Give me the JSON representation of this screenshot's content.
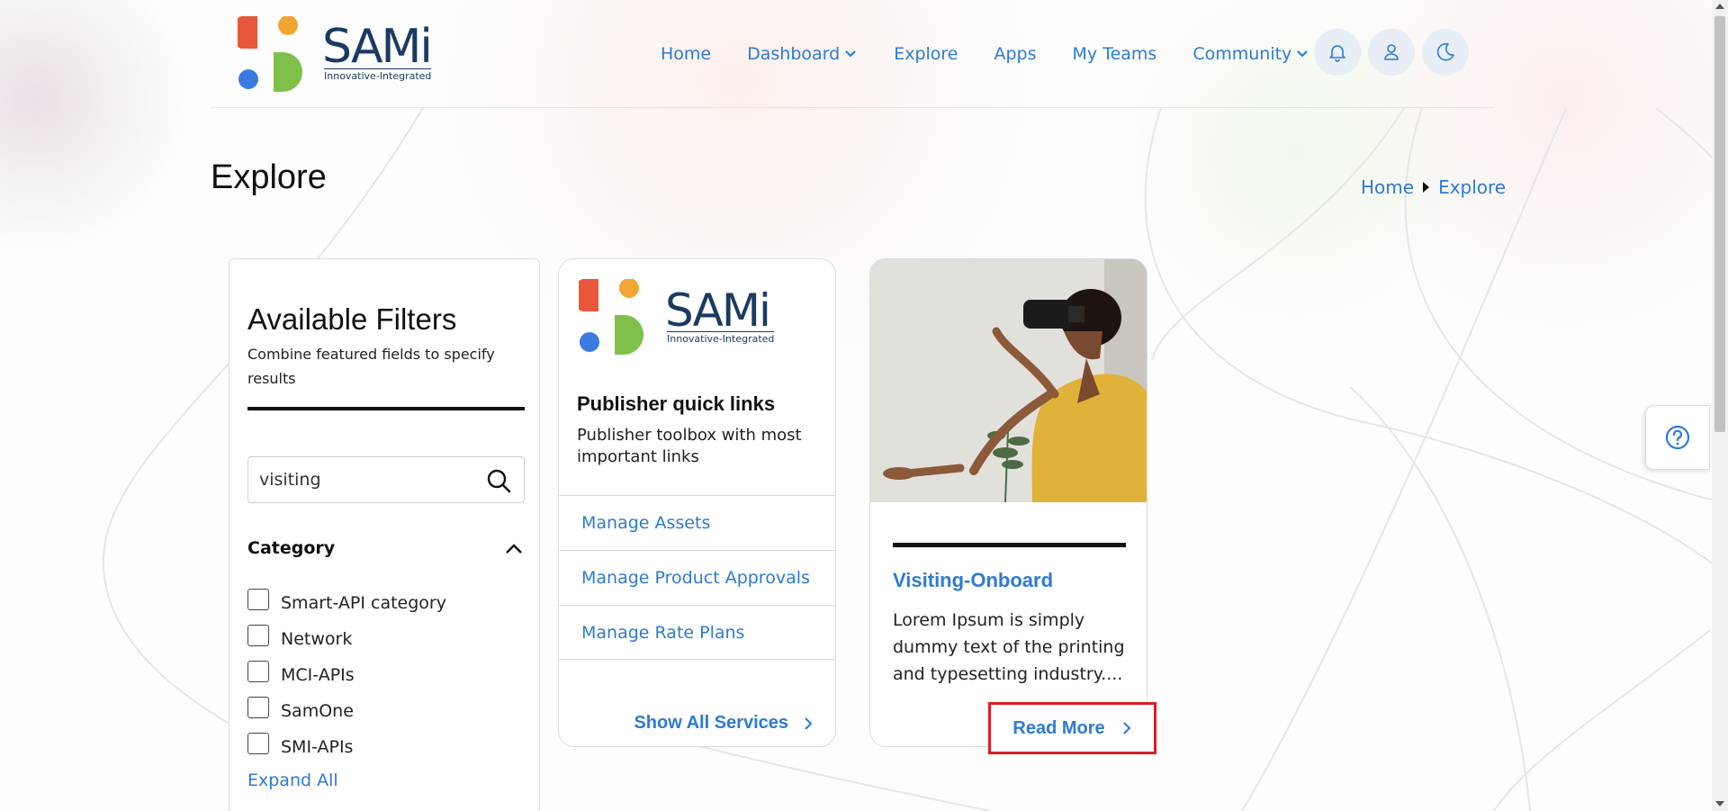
{
  "brand": {
    "name": "SAMi",
    "tagline": "Innovative-Integrated",
    "colors": {
      "orange_red": "#e8573a",
      "yellow": "#f2a632",
      "blue": "#3b7be0",
      "green": "#7ec04a",
      "navy": "#1b3a63"
    }
  },
  "nav": {
    "items": [
      {
        "label": "Home",
        "has_dropdown": false
      },
      {
        "label": "Dashboard",
        "has_dropdown": true
      },
      {
        "label": "Explore",
        "has_dropdown": false
      },
      {
        "label": "Apps",
        "has_dropdown": false
      },
      {
        "label": "My Teams",
        "has_dropdown": false
      },
      {
        "label": "Community",
        "has_dropdown": true
      }
    ],
    "icons": [
      "bell-icon",
      "user-icon",
      "moon-icon"
    ]
  },
  "page": {
    "title": "Explore",
    "breadcrumb": [
      "Home",
      "Explore"
    ]
  },
  "filters": {
    "title": "Available Filters",
    "subtitle": "Combine featured fields to specify results",
    "search_value": "visiting",
    "category_label": "Category",
    "categories": [
      "Smart-API category",
      "Network",
      "MCI-APIs",
      "SamOne",
      "SMI-APIs"
    ],
    "expand_label": "Expand All"
  },
  "publisher": {
    "title": "Publisher quick links",
    "subtitle": "Publisher toolbox with most important links",
    "links": [
      "Manage Assets",
      "Manage Product Approvals",
      "Manage Rate Plans"
    ],
    "show_all": "Show All Services"
  },
  "app_card": {
    "title": "Visiting-Onboard",
    "description": "Lorem Ipsum is simply dummy text of the printing and typesetting industry....",
    "read_more": "Read More"
  },
  "accent_color": "#2d7ad6",
  "highlight_color": "#e01b24"
}
